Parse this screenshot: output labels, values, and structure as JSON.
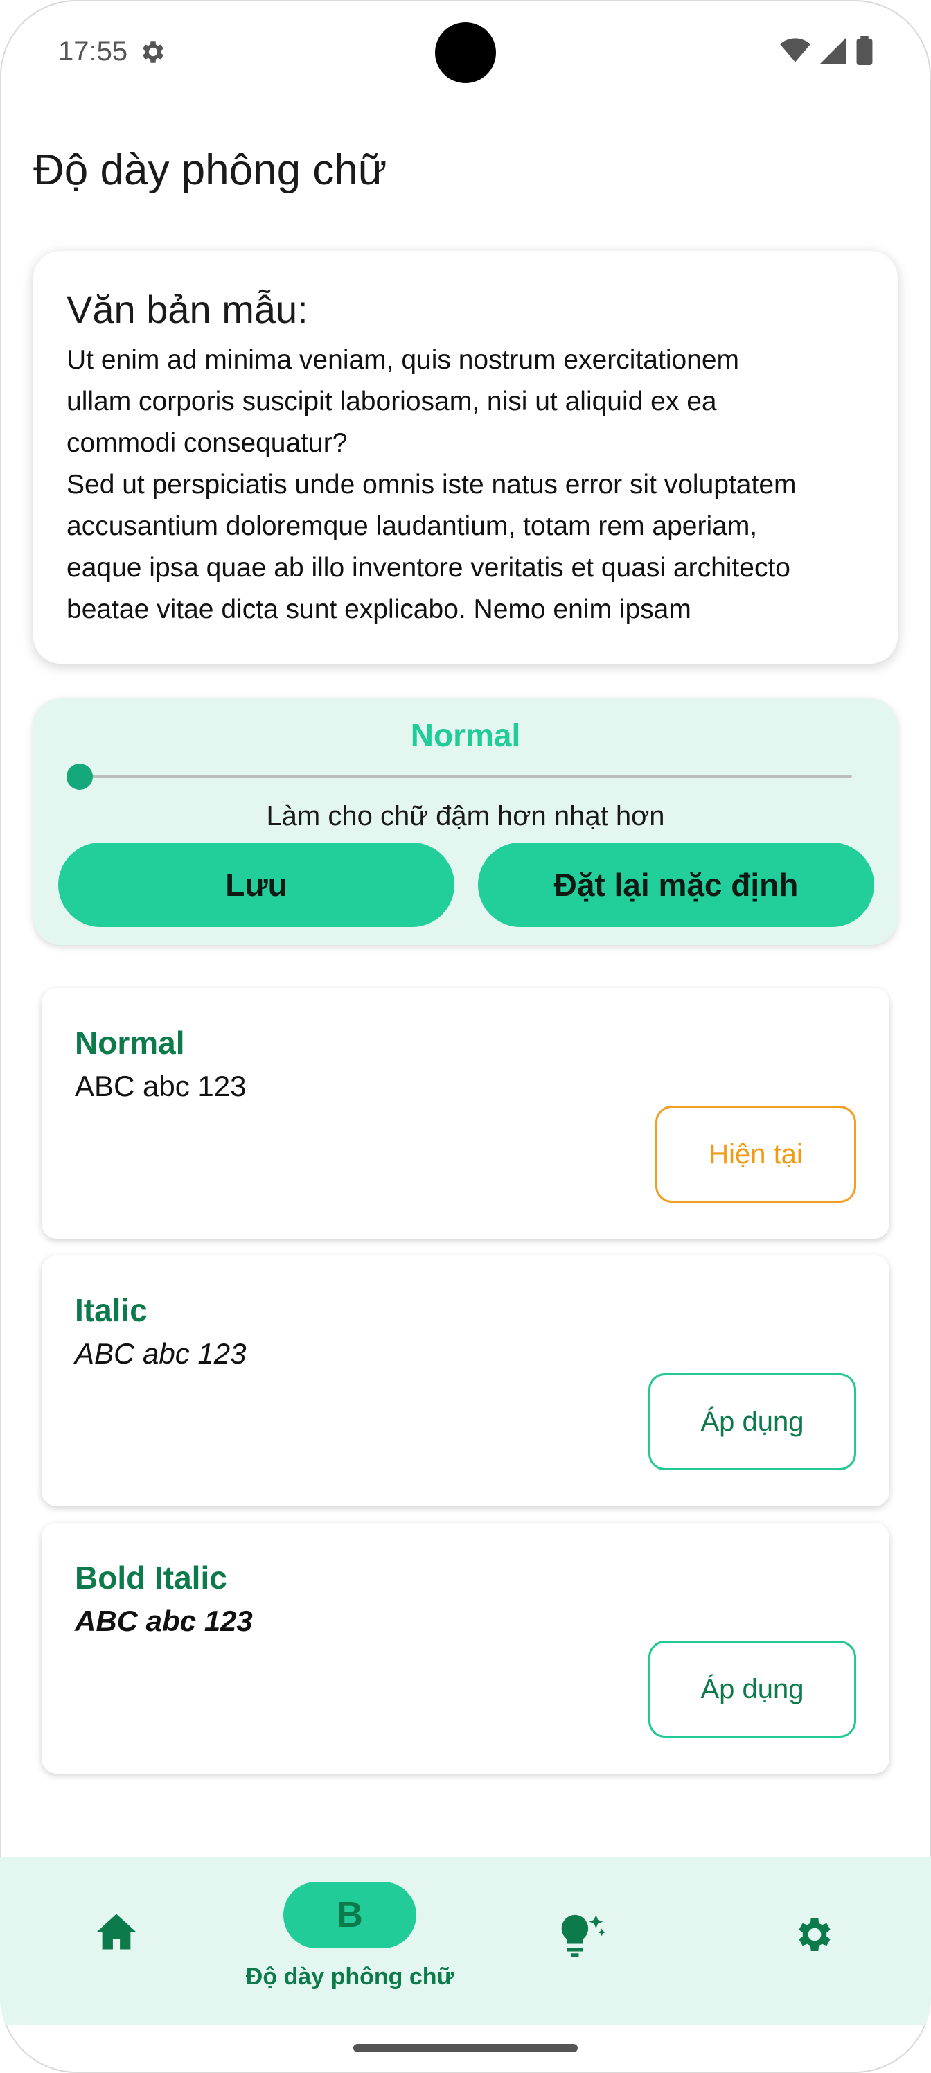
{
  "status_bar": {
    "time": "17:55"
  },
  "page": {
    "title": "Độ dày phông chữ"
  },
  "sample": {
    "heading": "Văn bản mẫu:",
    "text": "Ut enim ad minima veniam, quis nostrum exercitationem\nullam corporis suscipit laboriosam, nisi ut aliquid ex ea\ncommodi consequatur?\nSed ut perspiciatis unde omnis iste natus error sit voluptatem\naccusantium doloremque laudantium, totam rem aperiam,\neaque ipsa quae ab illo inventore veritatis et quasi architecto\nbeatae vitae dicta sunt explicabo. Nemo enim ipsam"
  },
  "control": {
    "current_weight": "Normal",
    "slider_value": 0,
    "hint": "Làm cho chữ đậm hơn nhạt hơn",
    "save_label": "Lưu",
    "reset_label": "Đặt lại mặc định"
  },
  "options": [
    {
      "name": "Normal",
      "sample": "ABC abc 123",
      "button": "Hiện tại",
      "state": "current"
    },
    {
      "name": "Italic",
      "sample": "ABC abc 123",
      "button": "Áp dụng",
      "state": "apply"
    },
    {
      "name": "Bold Italic",
      "sample": "ABC abc 123",
      "button": "Áp dụng",
      "state": "apply"
    }
  ],
  "bottom_nav": {
    "items": [
      {
        "icon": "home-icon",
        "label": ""
      },
      {
        "icon": "font-weight-icon",
        "icon_text": "B",
        "label": "Độ dày phông chữ",
        "active": true
      },
      {
        "icon": "lightbulb-icon",
        "label": ""
      },
      {
        "icon": "gear-icon",
        "label": ""
      }
    ]
  },
  "colors": {
    "accent": "#22cc99",
    "accent_dark": "#0d7a4c",
    "panel_bg": "#e3f6ef",
    "current_orange": "#f29a12"
  }
}
